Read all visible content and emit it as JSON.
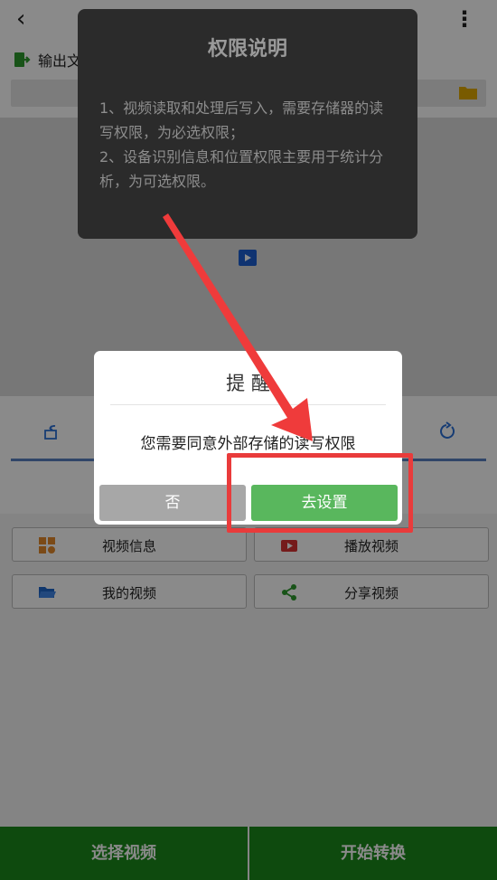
{
  "topbar": {
    "back_glyph": "‹",
    "menu_glyph": "⋮"
  },
  "output": {
    "label": "输出文"
  },
  "function_buttons": [
    {
      "label": "视频信息",
      "icon": "grid-icon"
    },
    {
      "label": "播放视频",
      "icon": "play-icon"
    },
    {
      "label": "我的视频",
      "icon": "folder-open-icon"
    },
    {
      "label": "分享视频",
      "icon": "share-icon"
    }
  ],
  "bottom_bar": {
    "select_video": "选择视频",
    "start_convert": "开始转换"
  },
  "permission_panel": {
    "title": "权限说明",
    "line1": "1、视频读取和处理后写入，需要存储器的读写权限，为必选权限；",
    "line2": "2、设备识别信息和位置权限主要用于统计分析，为可选权限。"
  },
  "dialog": {
    "title": "提 醒",
    "message": "您需要同意外部存储的读写权限",
    "no_label": "否",
    "yes_label": "去设置"
  },
  "colors": {
    "accent_green": "#1a8a1a",
    "confirm_green": "#59b75d",
    "highlight_red": "#e93b3b",
    "icon_blue": "#2a6fd6"
  }
}
